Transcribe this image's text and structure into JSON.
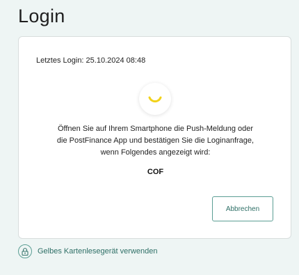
{
  "page": {
    "title": "Login"
  },
  "card": {
    "last_login": "Letztes Login: 25.10.2024 08:48",
    "instruction_lines": [
      "Öffnen Sie auf Ihrem Smartphone die Push-Meldung oder",
      "die PostFinance App und bestätigen Sie die Loginanfrage,",
      "wenn Folgendes angezeigt wird:"
    ],
    "code": "COF",
    "cancel_label": "Abbrechen"
  },
  "alternative": {
    "label": "Gelbes Kartenlesegerät verwenden",
    "icon": "lock-icon"
  },
  "colors": {
    "accent": "#5b9e94",
    "accent_text": "#2e6f66",
    "spinner": "#f2d21a",
    "background": "#eef5f4"
  }
}
